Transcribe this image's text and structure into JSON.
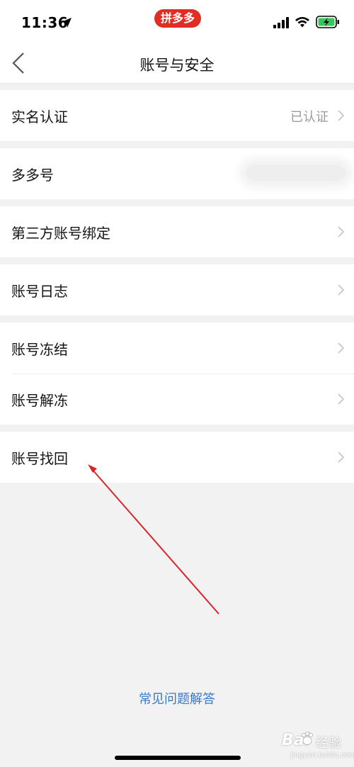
{
  "status_bar": {
    "time": "11:36",
    "app_badge": "拼多多"
  },
  "nav": {
    "title": "账号与安全"
  },
  "rows": {
    "real_name": {
      "label": "实名认证",
      "value": "已认证"
    },
    "duoduo_id": {
      "label": "多多号"
    },
    "third_party": {
      "label": "第三方账号绑定"
    },
    "log": {
      "label": "账号日志"
    },
    "freeze": {
      "label": "账号冻结"
    },
    "unfreeze": {
      "label": "账号解冻"
    },
    "recover": {
      "label": "账号找回"
    }
  },
  "faq_link": "常见问题解答",
  "watermark": {
    "brand": "Bai",
    "brand_suffix": "经验",
    "url": "jingyan.baidu.com"
  },
  "colors": {
    "brand_red": "#e02e24",
    "link_blue": "#3a78c9",
    "annotation_arrow": "#d9262b",
    "background": "#f2f2f2"
  }
}
